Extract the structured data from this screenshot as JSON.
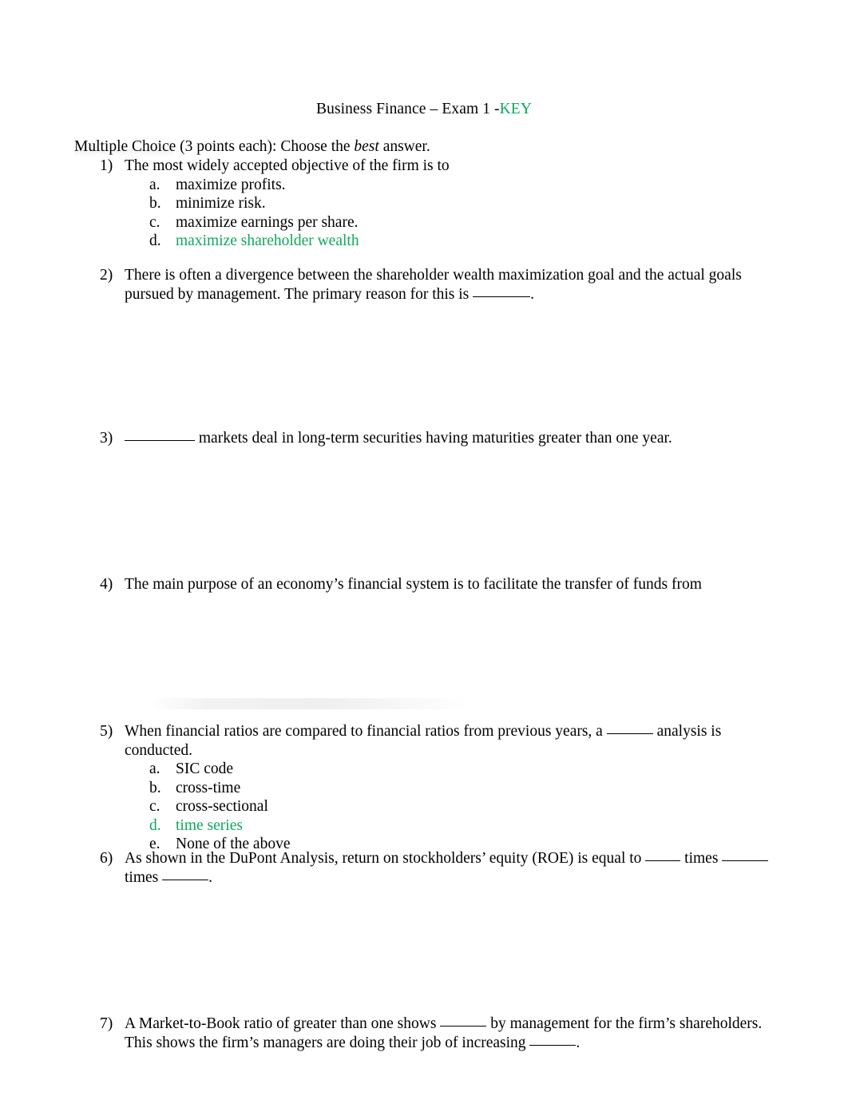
{
  "document": {
    "title_main": "Business Finance – Exam 1 -",
    "title_key": "KEY",
    "instructions_pre": "Multiple Choice (3 points each): Choose the ",
    "instructions_italic": "best",
    "instructions_post": " answer.",
    "answer_color": "#0fa85c",
    "text_color": "#000000",
    "background_color": "#ffffff"
  },
  "questions": [
    {
      "number": "1)",
      "text": "The most widely accepted objective of the firm is to",
      "options": [
        {
          "letter": "a.",
          "text": "maximize profits.",
          "is_answer": false
        },
        {
          "letter": "b.",
          "text": "minimize risk.",
          "is_answer": false
        },
        {
          "letter": "c.",
          "text": "maximize earnings per share.",
          "is_answer": false
        },
        {
          "letter": "d.",
          "text": "maximize shareholder wealth",
          "is_answer": true
        }
      ]
    },
    {
      "number": "2)",
      "line1": "There is often a divergence between the shareholder wealth maximization goal and the actual goals pursued",
      "line2_pre": "by management. The primary reason for this is ",
      "line2_post": ".",
      "options": []
    },
    {
      "number": "3)",
      "text_pre": "",
      "text_post": " markets deal in long-term securities having maturities greater than one year.",
      "options": []
    },
    {
      "number": "4)",
      "text": "The main purpose of an economy’s financial system is to facilitate the transfer of funds from",
      "options": []
    },
    {
      "number": "5)",
      "text_pre": "When financial ratios are compared to financial ratios from previous years, a ",
      "text_post": " analysis is conducted.",
      "options": [
        {
          "letter": "a.",
          "text": "SIC code",
          "is_answer": false
        },
        {
          "letter": "b.",
          "text": "cross-time",
          "is_answer": false
        },
        {
          "letter": "c.",
          "text": "cross-sectional",
          "is_answer": false
        },
        {
          "letter": "d.",
          "text": "time series",
          "is_answer": true
        },
        {
          "letter": "e.",
          "text": "None of the above",
          "is_answer": false
        }
      ]
    },
    {
      "number": "6)",
      "line1_pre": "As shown in the DuPont Analysis, return on stockholders’ equity (ROE) is equal to ",
      "line1_mid": " times ",
      "line2_pre": "times ",
      "line2_post": ".",
      "options": []
    },
    {
      "number": "7)",
      "line1_pre": "A Market-to-Book ratio of greater than one shows ",
      "line1_post": " by management for the firm’s shareholders.",
      "line2_pre": "This shows the firm’s managers are doing their job of increasing ",
      "line2_post": ".",
      "options": []
    }
  ]
}
